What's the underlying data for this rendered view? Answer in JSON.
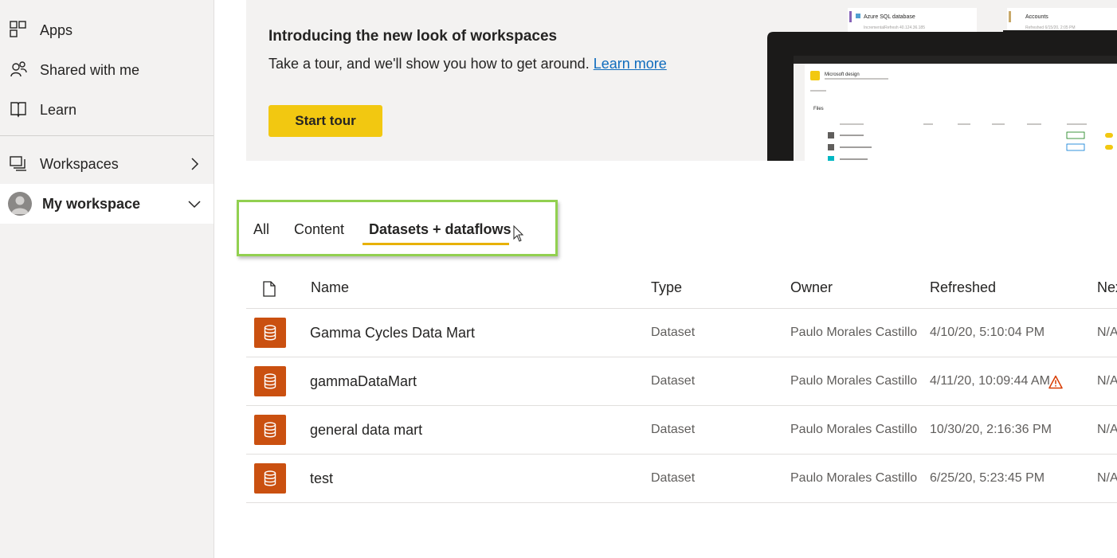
{
  "sidebar": {
    "items": [
      {
        "label": "Apps",
        "icon": "apps-icon"
      },
      {
        "label": "Shared with me",
        "icon": "shared-icon"
      },
      {
        "label": "Learn",
        "icon": "book-icon"
      }
    ],
    "workspaces_label": "Workspaces",
    "my_workspace_label": "My workspace"
  },
  "banner": {
    "title": "Introducing the new look of workspaces",
    "text": "Take a tour, and we'll show you how to get around.",
    "link": "Learn more",
    "button": "Start tour",
    "preview": {
      "card1": "Azure SQL database",
      "card1_sub": "IncrementalRefresh 40.124.36.185",
      "card2": "Accounts",
      "card2_sub": "Refreshed 6/15/20, 2:05 PM",
      "workspace_name": "Microsoft design",
      "section": "Files"
    }
  },
  "tabs": [
    {
      "label": "All",
      "active": false
    },
    {
      "label": "Content",
      "active": false
    },
    {
      "label": "Datasets + dataflows",
      "active": true
    }
  ],
  "table": {
    "headers": {
      "name": "Name",
      "type": "Type",
      "owner": "Owner",
      "refreshed": "Refreshed",
      "next": "Nex"
    },
    "rows": [
      {
        "name": "Gamma Cycles Data Mart",
        "type": "Dataset",
        "owner": "Paulo Morales Castillo",
        "refreshed": "4/10/20, 5:10:04 PM",
        "next": "N/A",
        "warning": false
      },
      {
        "name": "gammaDataMart",
        "type": "Dataset",
        "owner": "Paulo Morales Castillo",
        "refreshed": "4/11/20, 10:09:44 AM",
        "next": "N/A",
        "warning": true
      },
      {
        "name": "general data mart",
        "type": "Dataset",
        "owner": "Paulo Morales Castillo",
        "refreshed": "10/30/20, 2:16:36 PM",
        "next": "N/A",
        "warning": false
      },
      {
        "name": "test",
        "type": "Dataset",
        "owner": "Paulo Morales Castillo",
        "refreshed": "6/25/20, 5:23:45 PM",
        "next": "N/A",
        "warning": false
      }
    ]
  },
  "colors": {
    "accent_yellow": "#f2c811",
    "dataset_icon": "#ca5010",
    "highlight_box": "#92d050",
    "warning": "#d83b01"
  }
}
